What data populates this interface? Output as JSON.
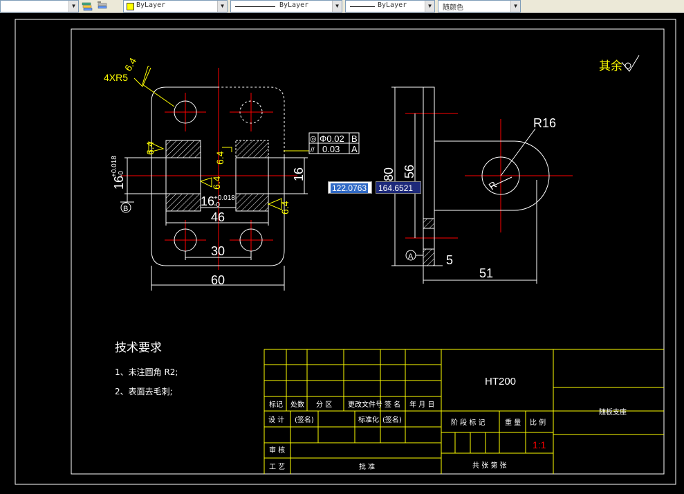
{
  "toolbar": {
    "layer_color": "ByLayer",
    "linetype": "ByLayer",
    "lineweight": "ByLayer",
    "plot_color": "随颜色",
    "icons": [
      "layer-states-icon",
      "layer-previous-icon"
    ]
  },
  "drawing": {
    "roughness_note": {
      "label": "其余",
      "symbol": "▽"
    },
    "holes_note": "4XR5",
    "surface_finish": [
      "6.4",
      "6.4",
      "6.4",
      "6.4",
      "6.4"
    ],
    "tolerance_frame": {
      "row1": {
        "symbol": "◎",
        "value": "Φ0.02",
        "datum": "B"
      },
      "row2": {
        "symbol": "//",
        "value": "0.03",
        "datum": "A"
      }
    },
    "dims": {
      "d60": "60",
      "d46": "46",
      "d30": "30",
      "d16_left": "16",
      "d16_left_tol_upper": "+0.018",
      "d16_left_tol_lower": "-0",
      "d16_mid": "16",
      "d16_mid_tol_upper": "+0.018",
      "d16_mid_tol_lower": "-0",
      "d16_right": "16",
      "d80": "80",
      "d56": "56",
      "d5": "5",
      "d51": "51",
      "r16": "R16",
      "r_small": "R"
    },
    "datum_labels": {
      "b": "B",
      "a": "A"
    },
    "tech_req": {
      "title": "技术要求",
      "item1": "1、未注圆角 R2;",
      "item2": "2、表面去毛刺;"
    }
  },
  "title_block": {
    "material": "HT200",
    "part_name": "随板支座",
    "scale": "1:1",
    "header_row": [
      "标记",
      "处数",
      "分 区",
      "更改文件号",
      "签 名",
      "年 月 日"
    ],
    "design": "设 计",
    "signed1": "(签名)",
    "standard": "标准化",
    "signed2": "(签名)",
    "stage_label": "阶 段 标 记",
    "weight_label": "重 量",
    "scale_label": "比 例",
    "review": "审 核",
    "process": "工 艺",
    "approve": "批 准",
    "sheets": "共  张 第  张"
  },
  "dynamic_input": {
    "x": "122.0763",
    "y": "164.6521"
  }
}
